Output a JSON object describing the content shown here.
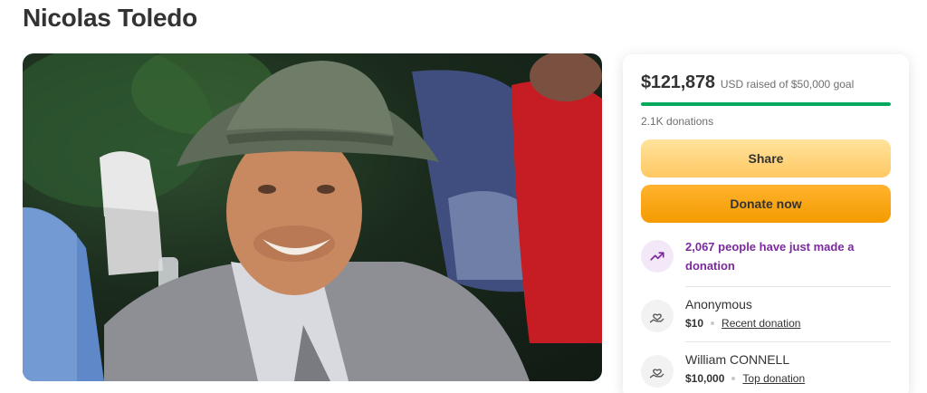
{
  "campaign": {
    "title": "Nicolas Toledo"
  },
  "photo": {
    "description": "campaign-photo"
  },
  "stats": {
    "raised_amount": "$121,878",
    "raised_text": "USD raised of $50,000 goal",
    "progress_fraction": 1.0,
    "donations_count": "2.1K donations"
  },
  "actions": {
    "share_label": "Share",
    "donate_label": "Donate now"
  },
  "notice": {
    "icon": "trending-up-icon",
    "text": "2,067 people have just made a donation"
  },
  "donors": [
    {
      "name": "Anonymous",
      "amount": "$10",
      "tag": "Recent donation",
      "icon": "donor-heart-hand-icon"
    },
    {
      "name": "William CONNELL",
      "amount": "$10,000",
      "tag": "Top donation",
      "icon": "donor-heart-hand-icon"
    }
  ],
  "colors": {
    "progress": "#02a95c",
    "share_button": "#ffc863",
    "donate_button": "#f49b00",
    "notice_text": "#7b2a9e"
  }
}
